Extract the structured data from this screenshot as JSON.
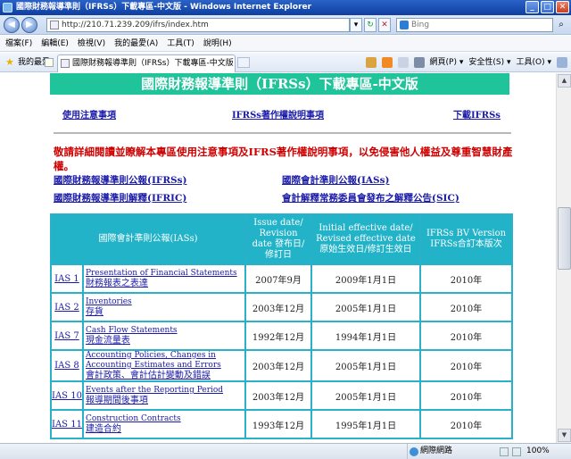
{
  "window": {
    "title": "國際財務報導準則（IFRSs）下載專區-中文版 - Windows Internet Explorer",
    "minimize": "_",
    "maximize": "□",
    "close": "✕"
  },
  "address": {
    "url": "http://210.71.239.209/ifrs/index.htm",
    "search_placeholder": "Bing",
    "back": "◀",
    "forward": "▶",
    "dropdown": "▾",
    "refresh": "↻",
    "stop": "✕",
    "search_go": "⌕"
  },
  "menu": [
    "檔案(F)",
    "編輯(E)",
    "檢視(V)",
    "我的最愛(A)",
    "工具(T)",
    "說明(H)"
  ],
  "favorites": {
    "label": "我的最愛",
    "tab_title": "國際財務報導準則（IFRSs）下載專區-中文版",
    "cmd_items": [
      "網頁(P) ▾",
      "安全性(S) ▾",
      "工具(O) ▾"
    ]
  },
  "page": {
    "banner": "國際財務報導準則（IFRSs）下載專區-中文版",
    "top_links": [
      "使用注意事項",
      "IFRSs著作權說明事項",
      "下載IFRSs"
    ],
    "notice": "敬請詳細閱讀並瞭解本專區使用注意事項及IFRS著作權說明事項，以免侵害他人權益及尊重智慧財產權。",
    "std_links": [
      "國際財務報導準則公報(IFRSs)",
      "國際會計準則公報(IASs)",
      "國際財務報導準則解釋(IFRIC)",
      "會計解釋常務委員會發布之解釋公告(SIC)"
    ],
    "table": {
      "headers": [
        "國際會計準則公報(IASs)",
        "Issue date/ Revision date 發布日/修訂日",
        "Initial effective date/ Revised effective date 原始生效日/修訂生效日",
        "IFRSs BV Version IFRSs合訂本版次"
      ],
      "rows": [
        {
          "code": "IAS 1",
          "en": "Presentation of Financial Statements",
          "zh": "財務報表之表達",
          "issue": "2007年9月",
          "effective": "2009年1月1日",
          "version": "2010年"
        },
        {
          "code": "IAS 2",
          "en": "Inventories",
          "zh": "存貨",
          "issue": "2003年12月",
          "effective": "2005年1月1日",
          "version": "2010年"
        },
        {
          "code": "IAS 7",
          "en": "Cash Flow Statements",
          "zh": "現金流量表",
          "issue": "1992年12月",
          "effective": "1994年1月1日",
          "version": "2010年"
        },
        {
          "code": "IAS 8",
          "en": "Accounting Policies, Changes in Accounting Estimates and Errors",
          "zh": "會計政策、會計估計變動及錯誤",
          "issue": "2003年12月",
          "effective": "2005年1月1日",
          "version": "2010年"
        },
        {
          "code": "IAS 10",
          "en": "Events after the Reporting Period",
          "zh": "報導期間後事項",
          "issue": "2003年12月",
          "effective": "2005年1月1日",
          "version": "2010年"
        },
        {
          "code": "IAS 11",
          "en": "Construction Contracts",
          "zh": "建造合約",
          "issue": "1993年12月",
          "effective": "1995年1月1日",
          "version": "2010年"
        }
      ]
    }
  },
  "status": {
    "zone": "網際網路",
    "zoom": "100%"
  }
}
